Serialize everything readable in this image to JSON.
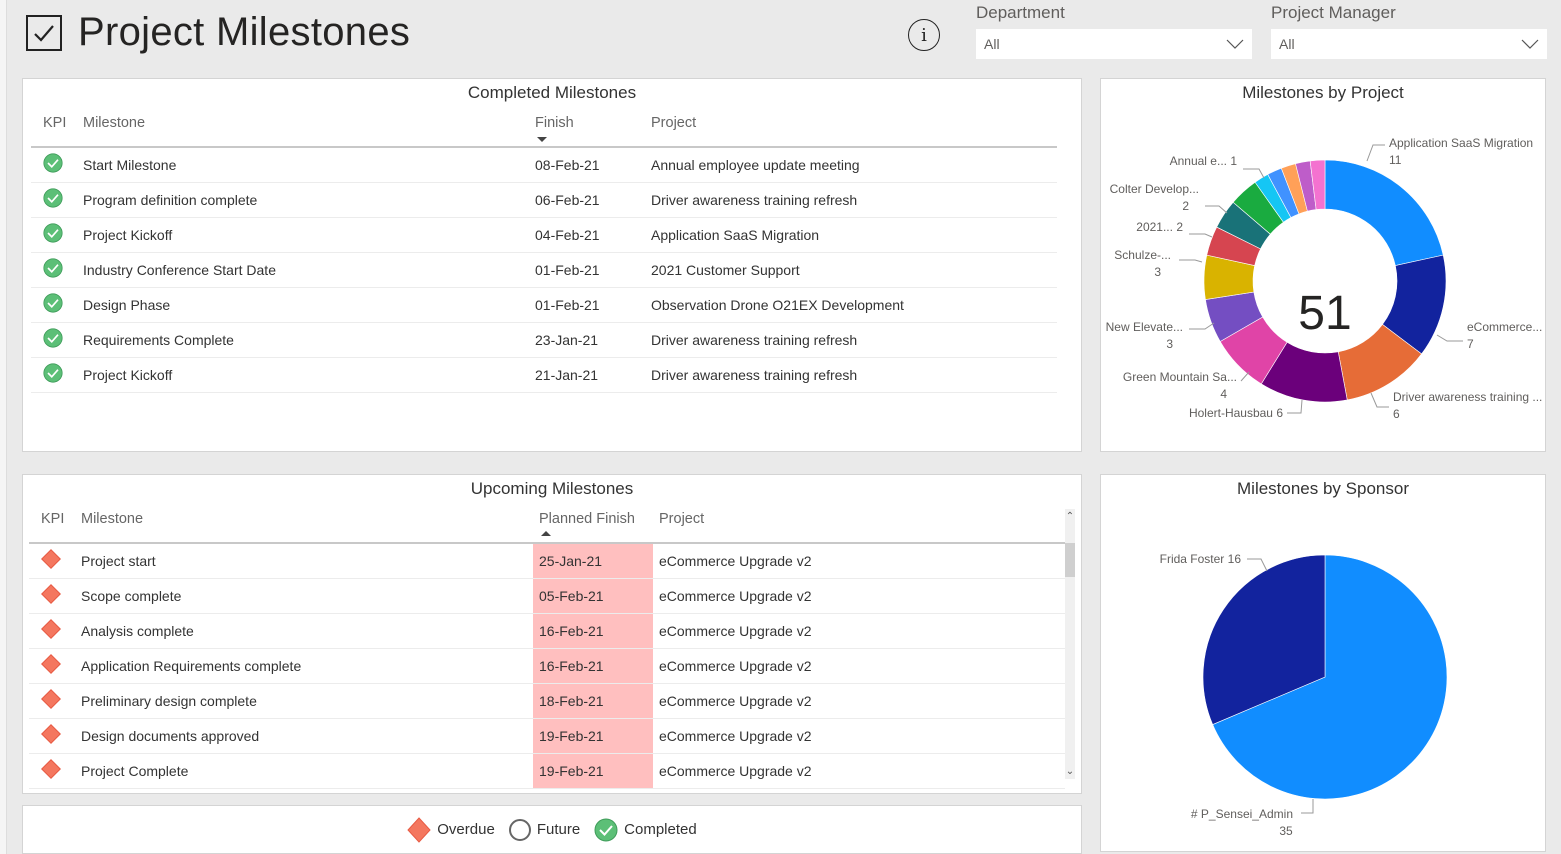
{
  "header": {
    "title": "Project Milestones",
    "info_icon": "info-icon",
    "title_icon": "checkbox-checked-icon"
  },
  "filters": [
    {
      "label": "Department",
      "value": "All"
    },
    {
      "label": "Project Manager",
      "value": "All"
    }
  ],
  "completed": {
    "title": "Completed Milestones",
    "columns": [
      "KPI",
      "Milestone",
      "Finish",
      "Project"
    ],
    "sort": {
      "column": "Finish",
      "direction": "descending"
    },
    "rows": [
      {
        "kpi": "completed",
        "milestone": "Start Milestone",
        "finish": "08-Feb-21",
        "project": "Annual employee update meeting"
      },
      {
        "kpi": "completed",
        "milestone": "Program definition complete",
        "finish": "06-Feb-21",
        "project": "Driver awareness training refresh"
      },
      {
        "kpi": "completed",
        "milestone": "Project Kickoff",
        "finish": "04-Feb-21",
        "project": "Application SaaS Migration"
      },
      {
        "kpi": "completed",
        "milestone": "Industry Conference Start Date",
        "finish": "01-Feb-21",
        "project": "2021 Customer Support"
      },
      {
        "kpi": "completed",
        "milestone": "Design Phase",
        "finish": "01-Feb-21",
        "project": "Observation Drone O21EX Development"
      },
      {
        "kpi": "completed",
        "milestone": "Requirements Complete",
        "finish": "23-Jan-21",
        "project": "Driver awareness training refresh"
      },
      {
        "kpi": "completed",
        "milestone": "Project Kickoff",
        "finish": "21-Jan-21",
        "project": "Driver awareness training refresh"
      }
    ]
  },
  "upcoming": {
    "title": "Upcoming Milestones",
    "columns": [
      "KPI",
      "Milestone",
      "Planned Finish",
      "Project"
    ],
    "sort": {
      "column": "Planned Finish",
      "direction": "ascending"
    },
    "rows": [
      {
        "kpi": "overdue",
        "milestone": "Project start",
        "finish": "25-Jan-21",
        "project": "eCommerce Upgrade v2"
      },
      {
        "kpi": "overdue",
        "milestone": "Scope complete",
        "finish": "05-Feb-21",
        "project": "eCommerce Upgrade v2"
      },
      {
        "kpi": "overdue",
        "milestone": "Analysis complete",
        "finish": "16-Feb-21",
        "project": "eCommerce Upgrade v2"
      },
      {
        "kpi": "overdue",
        "milestone": "Application Requirements complete",
        "finish": "16-Feb-21",
        "project": "eCommerce Upgrade v2"
      },
      {
        "kpi": "overdue",
        "milestone": "Preliminary design complete",
        "finish": "18-Feb-21",
        "project": "eCommerce Upgrade v2"
      },
      {
        "kpi": "overdue",
        "milestone": "Design documents approved",
        "finish": "19-Feb-21",
        "project": "eCommerce Upgrade v2"
      },
      {
        "kpi": "overdue",
        "milestone": "Project Complete",
        "finish": "19-Feb-21",
        "project": "eCommerce Upgrade v2"
      }
    ]
  },
  "legend": {
    "items": [
      {
        "icon": "overdue-diamond-icon",
        "label": "Overdue"
      },
      {
        "icon": "future-circle-icon",
        "label": "Future"
      },
      {
        "icon": "completed-check-icon",
        "label": "Completed"
      }
    ]
  },
  "colors": {
    "overdue": "#f4775f",
    "overdue_bg": "#ffbfbf",
    "completed": "#5cbf77"
  },
  "chart_data": [
    {
      "type": "pie",
      "variant": "donut",
      "title": "Milestones by Project",
      "center_label": "51",
      "slices": [
        {
          "label": "Application SaaS Migration",
          "display": "Application SaaS Migration",
          "value": 11,
          "color": "#118dff"
        },
        {
          "label": "eCommerce...",
          "display": "eCommerce...",
          "value": 7,
          "color": "#12239e"
        },
        {
          "label": "Driver awareness training ...",
          "display": "Driver awareness training ...",
          "value": 6,
          "color": "#e66c37"
        },
        {
          "label": "Holert-Hausbau",
          "display": "Holert-Hausbau 6",
          "value": 6,
          "color": "#6b007b"
        },
        {
          "label": "Green Mountain Sa...",
          "display": "Green Mountain Sa...",
          "value": 4,
          "color": "#e044a7"
        },
        {
          "label": "New Elevate...",
          "display": "New Elevate...",
          "value": 3,
          "color": "#744ec2"
        },
        {
          "label": "Schulze-...",
          "display": "Schulze-...",
          "value": 3,
          "color": "#d9b300"
        },
        {
          "label": "2021...",
          "display": "2021... 2",
          "value": 2,
          "color": "#d64550"
        },
        {
          "label": "Colter Develop...",
          "display": "Colter Develop...",
          "value": 2,
          "color": "#197278"
        },
        {
          "label": "",
          "display": "",
          "value": 2,
          "color": "#1aab40"
        },
        {
          "label": "Annual e...",
          "display": "Annual e... 1",
          "value": 1,
          "color": "#15c6f4"
        },
        {
          "label": "",
          "display": "",
          "value": 1,
          "color": "#4092ff"
        },
        {
          "label": "",
          "display": "",
          "value": 1,
          "color": "#ffa058"
        },
        {
          "label": "",
          "display": "",
          "value": 1,
          "color": "#be5dc9"
        },
        {
          "label": "",
          "display": "",
          "value": 1,
          "color": "#f472d0"
        }
      ]
    },
    {
      "type": "pie",
      "title": "Milestones by Sponsor",
      "slices": [
        {
          "label": "# P_Sensei_Admin",
          "value": 35,
          "color": "#118dff"
        },
        {
          "label": "Frida Foster",
          "value": 16,
          "color": "#12239e"
        }
      ]
    }
  ]
}
